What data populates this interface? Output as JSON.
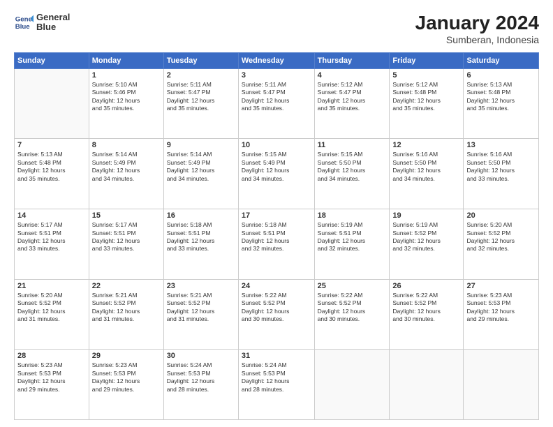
{
  "header": {
    "logo_line1": "General",
    "logo_line2": "Blue",
    "title": "January 2024",
    "subtitle": "Sumberan, Indonesia"
  },
  "columns": [
    "Sunday",
    "Monday",
    "Tuesday",
    "Wednesday",
    "Thursday",
    "Friday",
    "Saturday"
  ],
  "weeks": [
    [
      {
        "day": "",
        "text": ""
      },
      {
        "day": "1",
        "text": "Sunrise: 5:10 AM\nSunset: 5:46 PM\nDaylight: 12 hours\nand 35 minutes."
      },
      {
        "day": "2",
        "text": "Sunrise: 5:11 AM\nSunset: 5:47 PM\nDaylight: 12 hours\nand 35 minutes."
      },
      {
        "day": "3",
        "text": "Sunrise: 5:11 AM\nSunset: 5:47 PM\nDaylight: 12 hours\nand 35 minutes."
      },
      {
        "day": "4",
        "text": "Sunrise: 5:12 AM\nSunset: 5:47 PM\nDaylight: 12 hours\nand 35 minutes."
      },
      {
        "day": "5",
        "text": "Sunrise: 5:12 AM\nSunset: 5:48 PM\nDaylight: 12 hours\nand 35 minutes."
      },
      {
        "day": "6",
        "text": "Sunrise: 5:13 AM\nSunset: 5:48 PM\nDaylight: 12 hours\nand 35 minutes."
      }
    ],
    [
      {
        "day": "7",
        "text": "Sunrise: 5:13 AM\nSunset: 5:48 PM\nDaylight: 12 hours\nand 35 minutes."
      },
      {
        "day": "8",
        "text": "Sunrise: 5:14 AM\nSunset: 5:49 PM\nDaylight: 12 hours\nand 34 minutes."
      },
      {
        "day": "9",
        "text": "Sunrise: 5:14 AM\nSunset: 5:49 PM\nDaylight: 12 hours\nand 34 minutes."
      },
      {
        "day": "10",
        "text": "Sunrise: 5:15 AM\nSunset: 5:49 PM\nDaylight: 12 hours\nand 34 minutes."
      },
      {
        "day": "11",
        "text": "Sunrise: 5:15 AM\nSunset: 5:50 PM\nDaylight: 12 hours\nand 34 minutes."
      },
      {
        "day": "12",
        "text": "Sunrise: 5:16 AM\nSunset: 5:50 PM\nDaylight: 12 hours\nand 34 minutes."
      },
      {
        "day": "13",
        "text": "Sunrise: 5:16 AM\nSunset: 5:50 PM\nDaylight: 12 hours\nand 33 minutes."
      }
    ],
    [
      {
        "day": "14",
        "text": "Sunrise: 5:17 AM\nSunset: 5:51 PM\nDaylight: 12 hours\nand 33 minutes."
      },
      {
        "day": "15",
        "text": "Sunrise: 5:17 AM\nSunset: 5:51 PM\nDaylight: 12 hours\nand 33 minutes."
      },
      {
        "day": "16",
        "text": "Sunrise: 5:18 AM\nSunset: 5:51 PM\nDaylight: 12 hours\nand 33 minutes."
      },
      {
        "day": "17",
        "text": "Sunrise: 5:18 AM\nSunset: 5:51 PM\nDaylight: 12 hours\nand 32 minutes."
      },
      {
        "day": "18",
        "text": "Sunrise: 5:19 AM\nSunset: 5:51 PM\nDaylight: 12 hours\nand 32 minutes."
      },
      {
        "day": "19",
        "text": "Sunrise: 5:19 AM\nSunset: 5:52 PM\nDaylight: 12 hours\nand 32 minutes."
      },
      {
        "day": "20",
        "text": "Sunrise: 5:20 AM\nSunset: 5:52 PM\nDaylight: 12 hours\nand 32 minutes."
      }
    ],
    [
      {
        "day": "21",
        "text": "Sunrise: 5:20 AM\nSunset: 5:52 PM\nDaylight: 12 hours\nand 31 minutes."
      },
      {
        "day": "22",
        "text": "Sunrise: 5:21 AM\nSunset: 5:52 PM\nDaylight: 12 hours\nand 31 minutes."
      },
      {
        "day": "23",
        "text": "Sunrise: 5:21 AM\nSunset: 5:52 PM\nDaylight: 12 hours\nand 31 minutes."
      },
      {
        "day": "24",
        "text": "Sunrise: 5:22 AM\nSunset: 5:52 PM\nDaylight: 12 hours\nand 30 minutes."
      },
      {
        "day": "25",
        "text": "Sunrise: 5:22 AM\nSunset: 5:52 PM\nDaylight: 12 hours\nand 30 minutes."
      },
      {
        "day": "26",
        "text": "Sunrise: 5:22 AM\nSunset: 5:52 PM\nDaylight: 12 hours\nand 30 minutes."
      },
      {
        "day": "27",
        "text": "Sunrise: 5:23 AM\nSunset: 5:53 PM\nDaylight: 12 hours\nand 29 minutes."
      }
    ],
    [
      {
        "day": "28",
        "text": "Sunrise: 5:23 AM\nSunset: 5:53 PM\nDaylight: 12 hours\nand 29 minutes."
      },
      {
        "day": "29",
        "text": "Sunrise: 5:23 AM\nSunset: 5:53 PM\nDaylight: 12 hours\nand 29 minutes."
      },
      {
        "day": "30",
        "text": "Sunrise: 5:24 AM\nSunset: 5:53 PM\nDaylight: 12 hours\nand 28 minutes."
      },
      {
        "day": "31",
        "text": "Sunrise: 5:24 AM\nSunset: 5:53 PM\nDaylight: 12 hours\nand 28 minutes."
      },
      {
        "day": "",
        "text": ""
      },
      {
        "day": "",
        "text": ""
      },
      {
        "day": "",
        "text": ""
      }
    ]
  ]
}
